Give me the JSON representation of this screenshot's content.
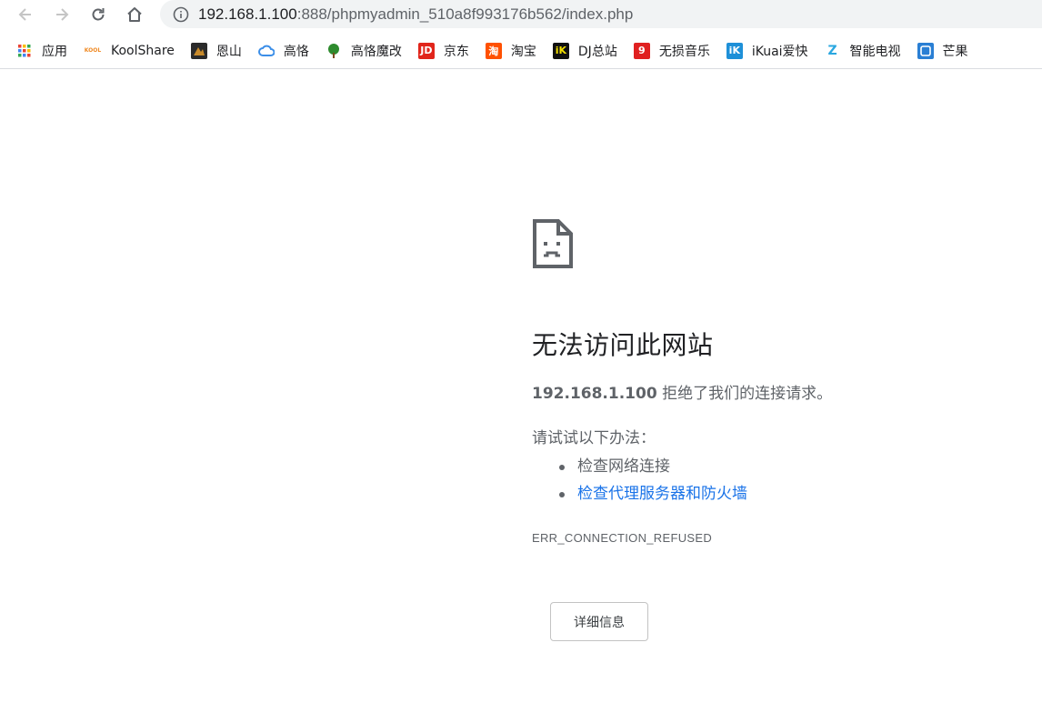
{
  "address_bar": {
    "url_host": "192.168.1.100",
    "url_rest": ":888/phpmyadmin_510a8f993176b562/index.php"
  },
  "bookmarks": [
    {
      "label": "应用",
      "icon": "apps-grid-icon",
      "icon_text": "",
      "color": "#ea4335"
    },
    {
      "label": "KoolShare",
      "icon": "koolshare-icon",
      "icon_text": "KOOL",
      "color": "#f08a24"
    },
    {
      "label": "恩山",
      "icon": "enshan-icon",
      "icon_text": "",
      "color": "#c98b2b"
    },
    {
      "label": "高恪",
      "icon": "cloud-icon",
      "icon_text": "",
      "color": "#3b8ee8"
    },
    {
      "label": "高恪魔改",
      "icon": "tree-icon",
      "icon_text": "",
      "color": "#2e8b2e"
    },
    {
      "label": "京东",
      "icon": "jd-icon",
      "icon_text": "JD",
      "color": "#e1251b"
    },
    {
      "label": "淘宝",
      "icon": "taobao-icon",
      "icon_text": "淘",
      "color": "#ff5000"
    },
    {
      "label": "DJ总站",
      "icon": "dj-icon",
      "icon_text": "iK",
      "color": "#111111"
    },
    {
      "label": "无损音乐",
      "icon": "music-icon",
      "icon_text": "9",
      "color": "#e02020"
    },
    {
      "label": "iKuai爱快",
      "icon": "ikuai-icon",
      "icon_text": "iK",
      "color": "#1e90d8"
    },
    {
      "label": "智能电视",
      "icon": "tv-icon",
      "icon_text": "Z",
      "color": "#2aa7e0"
    },
    {
      "label": "芒果",
      "icon": "mango-icon",
      "icon_text": "",
      "color": "#2a7fd4"
    }
  ],
  "error": {
    "title": "无法访问此网站",
    "host": "192.168.1.100",
    "desc_rest": " 拒绝了我们的连接请求。",
    "try_heading": "请试试以下办法：",
    "suggestions": [
      "检查网络连接",
      "检查代理服务器和防火墙"
    ],
    "code": "ERR_CONNECTION_REFUSED",
    "details_button": "详细信息"
  },
  "colors": {
    "link": "#1a73e8",
    "text_muted": "#5f6368",
    "title": "#202124"
  }
}
